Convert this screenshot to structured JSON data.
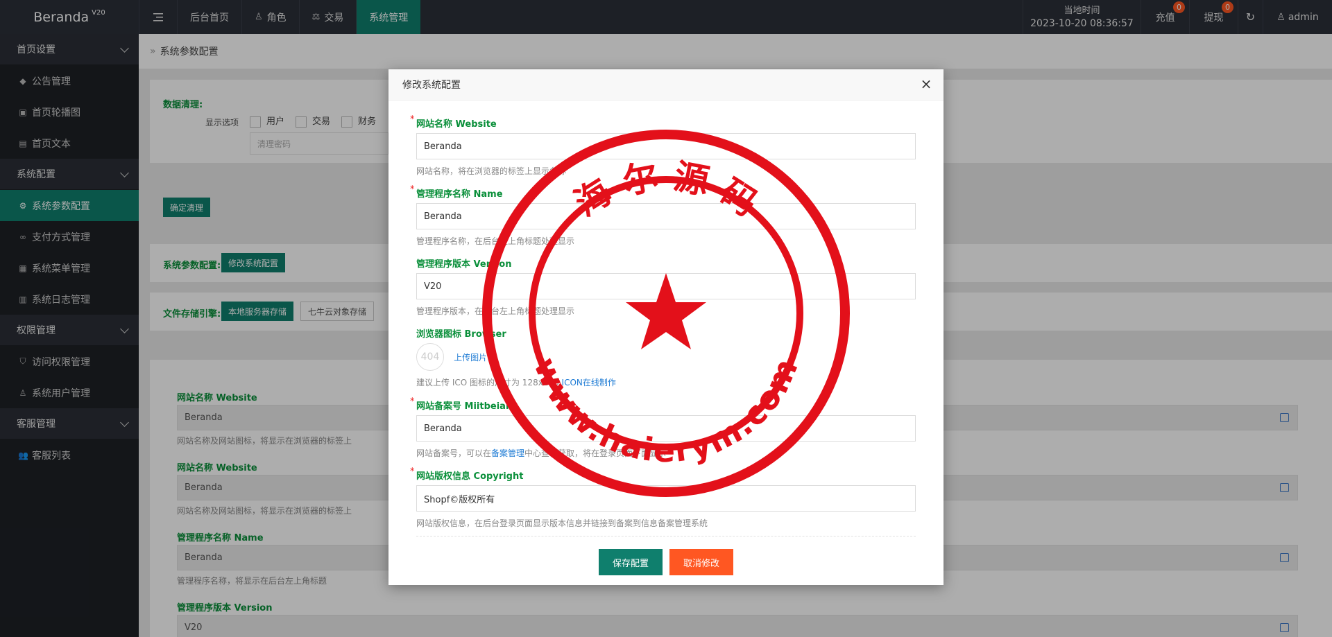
{
  "brand": {
    "name": "Beranda",
    "version": "V20"
  },
  "topnav": {
    "menu_icon": "hamburger-icon",
    "items": [
      {
        "label": "后台首页",
        "icon": ""
      },
      {
        "label": "角色",
        "icon": "user-icon"
      },
      {
        "label": "交易",
        "icon": "scale-icon"
      },
      {
        "label": "系统管理",
        "icon": "",
        "active": true
      }
    ]
  },
  "topright": {
    "time_label": "当地时间",
    "time_value": "2023-10-20 08:36:57",
    "recharge": {
      "label": "充值",
      "badge": "0"
    },
    "withdraw": {
      "label": "提现",
      "badge": "0"
    },
    "user": "admin"
  },
  "sidebar": {
    "groups": [
      {
        "label": "首页设置",
        "items": [
          {
            "label": "公告管理",
            "icon": "megaphone-icon"
          },
          {
            "label": "首页轮播图",
            "icon": "image-icon"
          },
          {
            "label": "首页文本",
            "icon": "document-icon"
          }
        ]
      },
      {
        "label": "系统配置",
        "items": [
          {
            "label": "系统参数配置",
            "icon": "gear-icon",
            "active": true
          },
          {
            "label": "支付方式管理",
            "icon": "link-icon"
          },
          {
            "label": "系统菜单管理",
            "icon": "calendar-icon"
          },
          {
            "label": "系统日志管理",
            "icon": "log-icon"
          }
        ]
      },
      {
        "label": "权限管理",
        "items": [
          {
            "label": "访问权限管理",
            "icon": "shield-icon"
          },
          {
            "label": "系统用户管理",
            "icon": "user-icon"
          }
        ]
      },
      {
        "label": "客服管理",
        "items": [
          {
            "label": "客服列表",
            "icon": "users-icon"
          }
        ]
      }
    ]
  },
  "breadcrumb": {
    "label": "系统参数配置"
  },
  "clean": {
    "title": "数据清理:",
    "options_label": "显示选项",
    "options": [
      "用户",
      "交易",
      "财务"
    ],
    "password_placeholder": "清理密码",
    "confirm_label": "确定清理"
  },
  "sysparam": {
    "title": "系统参数配置:",
    "button": "修改系统配置"
  },
  "storage": {
    "title": "文件存储引擎:",
    "options": [
      "本地服务器存储",
      "七牛云对象存储"
    ]
  },
  "bg_fields": [
    {
      "label": "网站名称 Website",
      "value": "Beranda",
      "help": "网站名称及网站图标，将显示在浏览器的标签上"
    },
    {
      "label": "网站名称 Website",
      "value": "Beranda",
      "help": "网站名称及网站图标，将显示在浏览器的标签上"
    },
    {
      "label": "管理程序名称 Name",
      "value": "Beranda",
      "help": "管理程序名称，将显示在后台左上角标题"
    },
    {
      "label": "管理程序版本 Version",
      "value": "V20",
      "help": ""
    }
  ],
  "modal": {
    "title": "修改系统配置",
    "close": "×",
    "fields": [
      {
        "label": "网站名称 Website",
        "required": true,
        "value": "Beranda",
        "help": "网站名称，将在浏览器的标签上显示名称"
      },
      {
        "label": "管理程序名称 Name",
        "required": true,
        "value": "Beranda",
        "help": "管理程序名称，在后台左上角标题处理显示"
      },
      {
        "label": "管理程序版本 Version",
        "required": false,
        "value": "V20",
        "help": "管理程序版本，在后台左上角标题处理显示"
      },
      {
        "label": "网站备案号 Miitbeian",
        "required": true,
        "value": "Beranda",
        "help_pre": "网站备案号，可以在",
        "help_link": "备案管理",
        "help_post": "中心查询获取，将在登录页面下面显示"
      },
      {
        "label": "网站版权信息 Copyright",
        "required": true,
        "value": "Shopf©版权所有",
        "help": "网站版权信息，在后台登录页面显示版本信息并链接到备案到信息备案管理系统"
      }
    ],
    "browser_icon": {
      "label": "浏览器图标 Browser",
      "placeholder": "404",
      "upload": "上传图片",
      "help_pre": "建议上传 ICO 图标的尺寸为 128x128 ",
      "help_link": "ICON在线制作"
    },
    "save": "保存配置",
    "cancel": "取消修改"
  },
  "watermark": {
    "top": "海 尔 源 码",
    "bottom": "www.haierym.com",
    "color": "#e3101a"
  }
}
